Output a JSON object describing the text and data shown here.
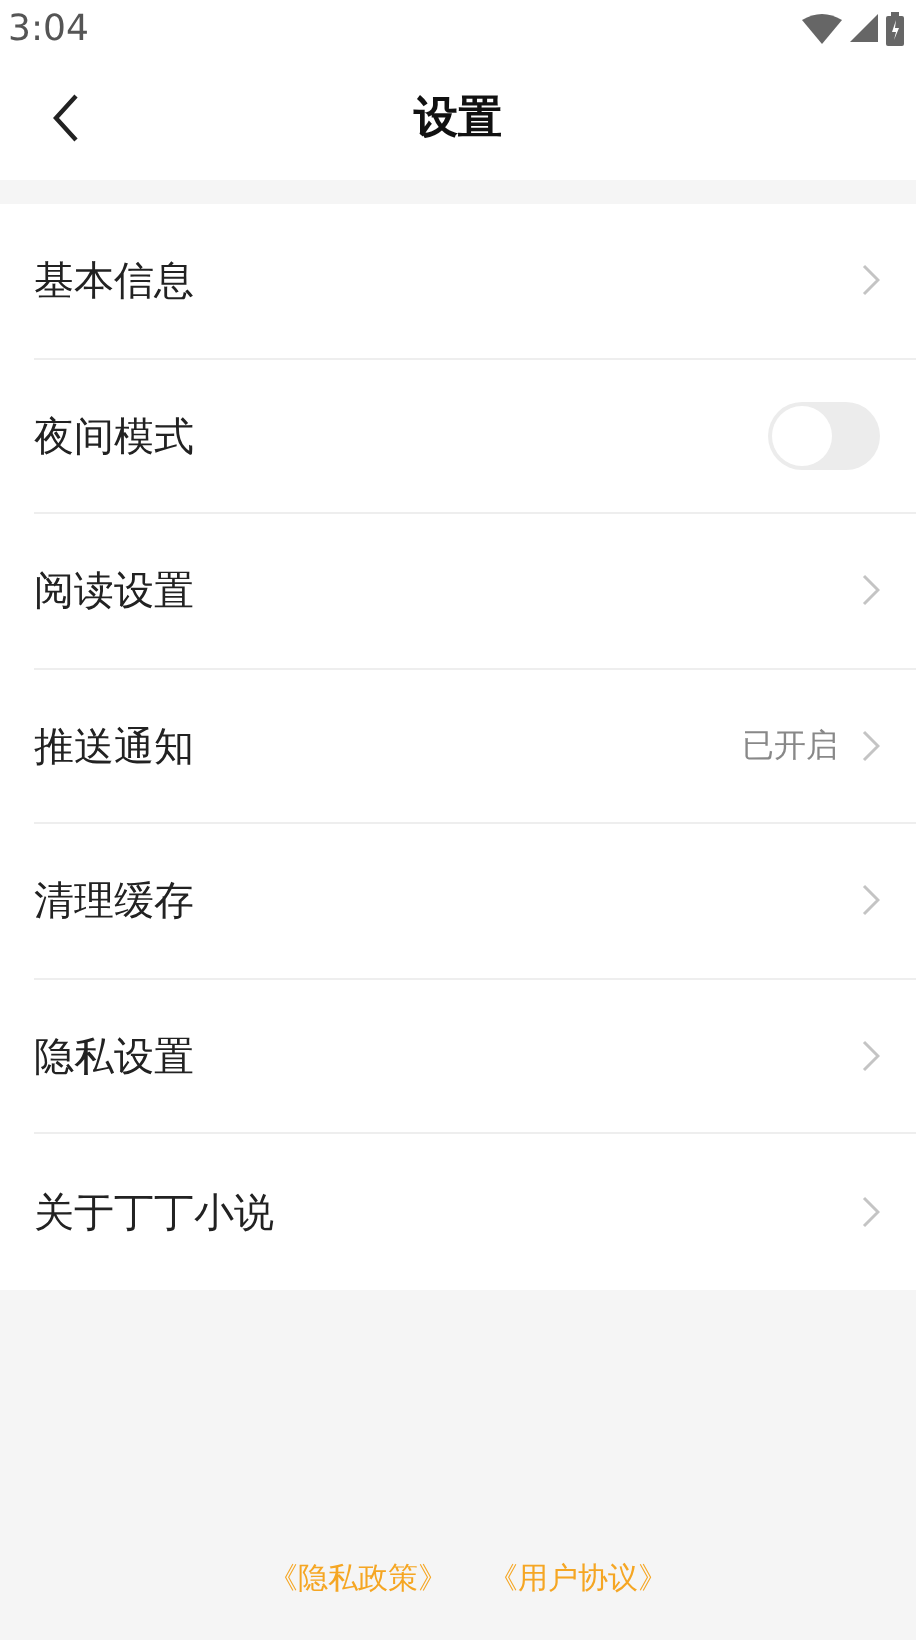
{
  "status_bar": {
    "time": "3:04"
  },
  "header": {
    "title": "设置"
  },
  "items": [
    {
      "kind": "link",
      "label": "基本信息"
    },
    {
      "kind": "toggle",
      "label": "夜间模式",
      "on": false
    },
    {
      "kind": "link",
      "label": "阅读设置"
    },
    {
      "kind": "link",
      "label": "推送通知",
      "value": "已开启"
    },
    {
      "kind": "link",
      "label": "清理缓存"
    },
    {
      "kind": "link",
      "label": "隐私设置"
    },
    {
      "kind": "link",
      "label": "关于丁丁小说"
    }
  ],
  "footer_links": [
    "《隐私政策》",
    "《用户协议》"
  ]
}
